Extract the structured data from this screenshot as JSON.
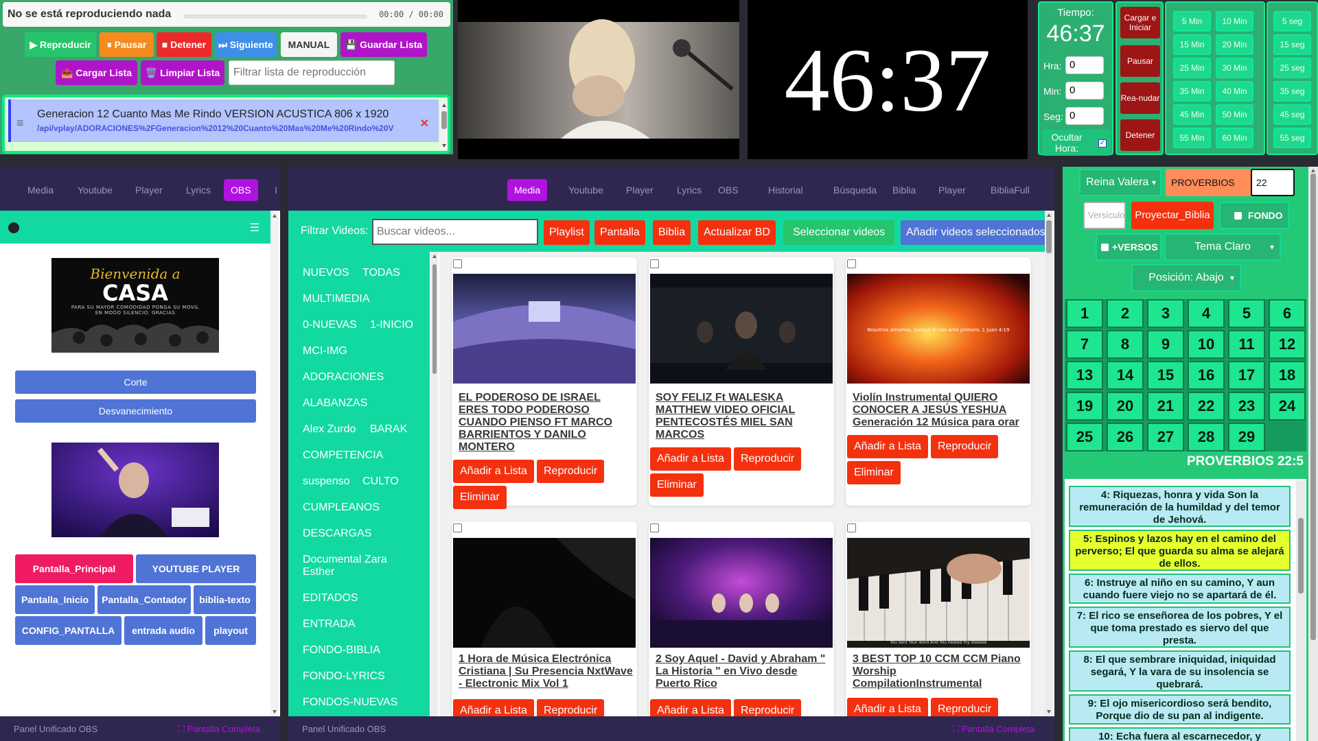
{
  "player": {
    "status": "No se está reproduciendo nada",
    "time": "00:00 / 00:00",
    "buttons": {
      "play": "▶ Reproducir",
      "pause": "⏸ Pausar",
      "stop": "■ Detener",
      "next": "⏭ Siguiente",
      "manual": "MANUAL",
      "save": "💾 Guardar Lista",
      "load": "📤 Cargar Lista",
      "clear": "🗑️ Limpiar Lista"
    },
    "filter_placeholder": "Filtrar lista de reproducción",
    "playlist_item": {
      "title": "Generacion 12 Cuanto Mas Me Rindo VERSION ACUSTICA 806 x 1920",
      "path": "/api/vplay/ADORACIONES%2FGeneracion%2012%20Cuanto%20Mas%20Me%20Rindo%20V"
    }
  },
  "timer": {
    "big_display": "46:37",
    "label": "Tiempo:",
    "value": "46:37",
    "hour_label": "Hra:",
    "min_label": "Min:",
    "sec_label": "Seg:",
    "hour_value": "0",
    "min_value": "0",
    "sec_value": "0",
    "hide_hour": "Ocultar Hora:",
    "hide_hour_checked": "✓",
    "controls": [
      "Cargar e Iniciar",
      "Pausar",
      "Rea-nudar",
      "Detener"
    ],
    "minutes": [
      "5 Min",
      "10 Min",
      "15 Min",
      "20 Min",
      "25 Min",
      "30 Min",
      "35 Min",
      "40 Min",
      "45 Min",
      "50 Min",
      "55 Min",
      "60 Min"
    ],
    "seconds": [
      "5 seg",
      "15 seg",
      "25 seg",
      "35 seg",
      "45 seg",
      "55 seg"
    ]
  },
  "left": {
    "tabs": [
      "Media",
      "Youtube",
      "Player",
      "Lyrics",
      "OBS",
      "I"
    ],
    "active_tab": "OBS",
    "welcome_title": "Bienvenida a",
    "welcome_big": "CASA",
    "welcome_sub": "PARA SU MAYOR COMODIDAD PONGA SU MOVIL EN MODO SILENCIO. GRACIAS",
    "transitions": [
      "Corte",
      "Desvanecimiento"
    ],
    "scene_buttons": [
      "Pantalla_Principal",
      "YOUTUBE PLAYER",
      "Pantalla_Inicio",
      "Pantalla_Contador",
      "biblia-texto",
      "CONFIG_PANTALLA",
      "entrada audio",
      "playout"
    ],
    "footer_left": "Panel Unificado OBS",
    "footer_right": "⛶ Pantalla Completa"
  },
  "center": {
    "tabs": [
      "Media",
      "Youtube",
      "Player",
      "Lyrics",
      "OBS",
      "Historial",
      "Búsqueda",
      "Biblia",
      "Player",
      "BibliaFull"
    ],
    "active_tab": "Media",
    "filter_label": "Filtrar Videos:",
    "search_placeholder": "Buscar videos...",
    "filter_buttons": [
      "Playlist",
      "Pantalla",
      "Biblia",
      "Actualizar BD",
      "Seleccionar videos",
      "Añadir videos seleccionados"
    ],
    "categories": [
      [
        "NUEVOS",
        "TODAS"
      ],
      [
        "MULTIMEDIA"
      ],
      [
        "0-NUEVAS",
        "1-INICIO"
      ],
      [
        "MCI-IMG"
      ],
      [
        "ADORACIONES"
      ],
      [
        "ALABANZAS"
      ],
      [
        "Alex Zurdo",
        "BARAK"
      ],
      [
        "COMPETENCIA"
      ],
      [
        "suspenso",
        "CULTO"
      ],
      [
        "CUMPLEANOS"
      ],
      [
        "DESCARGAS"
      ],
      [
        "Documental Zara Esther"
      ],
      [
        "EDITADOS"
      ],
      [
        "ENTRADA"
      ],
      [
        "FONDO-BIBLIA"
      ],
      [
        "FONDO-LYRICS"
      ],
      [
        "FONDOS-NUEVAS"
      ]
    ],
    "videos": [
      {
        "title": "EL PODEROSO DE ISRAEL ERES TODO PODEROSO CUANDO PIENSO FT MARCO BARRIENTOS Y DANILO MONTERO"
      },
      {
        "title": "SOY FELIZ Ft WALESKA MATTHEW VIDEO OFICIAL PENTECOSTÉS MIEL SAN MARCOS"
      },
      {
        "title": "Violín Instrumental QUIERO CONOCER A JESÚS YESHUA Generación 12 Música para orar"
      },
      {
        "title": "1 Hora de Música Electrónica Cristiana | Su Presencia NxtWave - Electronic Mix Vol 1"
      },
      {
        "title": "2 Soy Aquel - David y Abraham \" La Historia \" en Vivo desde Puerto Rico"
      },
      {
        "title": "3 BEST TOP 10 CCM CCM Piano Worship CompilationInstrumental"
      }
    ],
    "card_buttons": {
      "add": "Añadir a Lista",
      "play": "Reproducir",
      "delete": "Eliminar"
    },
    "thumb_caption_3": "Nosotros amamos, porque Él nos amó primero. 1 Juan 4:19",
    "thumb_caption_6": "You sent Your word And You healed my disease",
    "footer_left": "Panel Unificado OBS",
    "footer_right": "⛶ Pantalla Completa"
  },
  "bible": {
    "version": "Reina Valera",
    "book": "PROVERBIOS",
    "chapter_input": "22",
    "verse_placeholder": "Versículo",
    "project_button": "Proyectar_Biblia",
    "fondo_label": "FONDO",
    "mas_versos_label": "+VERSOS",
    "theme": "Tema Claro",
    "position": "Posición: Abajo",
    "chapters": [
      "1",
      "2",
      "3",
      "4",
      "5",
      "6",
      "7",
      "8",
      "9",
      "10",
      "11",
      "12",
      "13",
      "14",
      "15",
      "16",
      "17",
      "18",
      "19",
      "20",
      "21",
      "22",
      "23",
      "24",
      "25",
      "26",
      "27",
      "28",
      "29"
    ],
    "reference": "PROVERBIOS 22:5",
    "verses": [
      "4: Riquezas, honra y vida Son la remuneración de la humildad y del temor de Jehová.",
      "5: Espinos y lazos hay en el camino del perverso; El que guarda su alma se alejará de ellos.",
      "6: Instruye al niño en su camino, Y aun cuando fuere viejo no se apartará de él.",
      "7: El rico se enseñorea de los pobres, Y el que toma prestado es siervo del que presta.",
      "8: El que sembrare iniquidad, iniquidad segará, Y la vara de su insolencia se quebrará.",
      "9: El ojo misericordioso será bendito, Porque dio de su pan al indigente.",
      "10: Echa fuera al escarnecedor, y"
    ],
    "selected_verse_index": 1
  },
  "colors": {
    "green_panel": "#3aa76a",
    "mint": "#12d9a2",
    "dark_nav": "#2f2750",
    "purple_active": "#b012e0",
    "red_button": "#f4310f",
    "blue_button": "#4f74d6"
  }
}
